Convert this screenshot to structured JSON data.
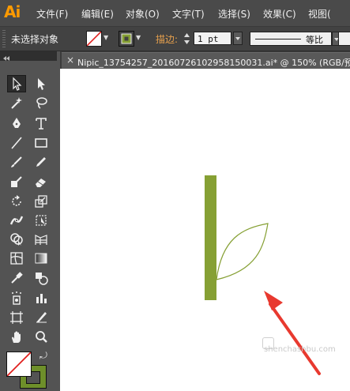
{
  "app": {
    "logo": "Ai"
  },
  "menu": {
    "items": [
      "文件(F)",
      "编辑(E)",
      "对象(O)",
      "文字(T)",
      "选择(S)",
      "效果(C)",
      "视图("
    ]
  },
  "control_bar": {
    "selection_status": "未选择对象",
    "stroke_label": "描边:",
    "stroke_weight": "1 pt",
    "profile_label": "等比"
  },
  "document": {
    "tab_title": "Nipic_13754257_20160726102958150031.ai* @ 150% (RGB/预",
    "close_glyph": "×"
  },
  "artwork": {
    "stem_color": "#86a034",
    "leaf_color": "#86a034",
    "arrow_color": "#e8392f"
  },
  "watermark": {
    "text": "shenchashbu.com"
  },
  "tools": [
    "selection-tool",
    "direct-selection-tool",
    "magic-wand-tool",
    "lasso-tool",
    "pen-tool",
    "type-tool",
    "line-segment-tool",
    "rectangle-tool",
    "paintbrush-tool",
    "pencil-tool",
    "blob-brush-tool",
    "eraser-tool",
    "rotate-tool",
    "scale-tool",
    "width-tool",
    "free-transform-tool",
    "shape-builder-tool",
    "perspective-grid-tool",
    "mesh-tool",
    "gradient-tool",
    "eyedropper-tool",
    "blend-tool",
    "symbol-sprayer-tool",
    "column-graph-tool",
    "artboard-tool",
    "slice-tool",
    "hand-tool",
    "zoom-tool"
  ]
}
